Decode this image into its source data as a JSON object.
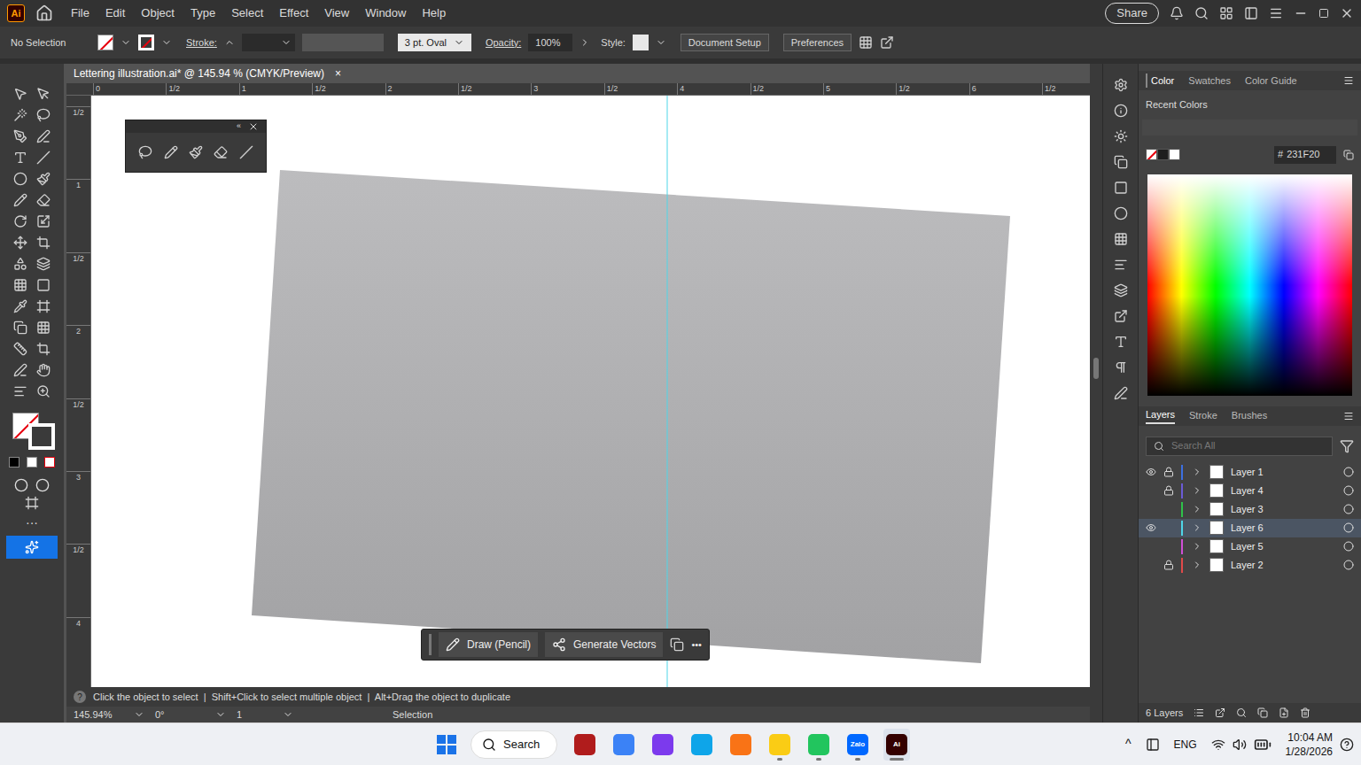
{
  "app": {
    "logo": "Ai"
  },
  "menu": [
    "File",
    "Edit",
    "Object",
    "Type",
    "Select",
    "Effect",
    "View",
    "Window",
    "Help"
  ],
  "share_button": "Share",
  "control_bar": {
    "selection": "No Selection",
    "stroke_label": "Stroke:",
    "brush": "3 pt. Oval",
    "opacity_label": "Opacity:",
    "opacity": "100%",
    "style_label": "Style:",
    "buttons": [
      "Document Setup",
      "Preferences"
    ]
  },
  "document_tab": {
    "title": "Lettering illustration.ai* @ 145.94 % (CMYK/Preview)",
    "close": "×"
  },
  "rulers": {
    "top": [
      "0",
      "1/2",
      "1",
      "1/2",
      "2",
      "1/2",
      "3",
      "1/2",
      "4",
      "1/2",
      "5",
      "1/2",
      "6",
      "1/2"
    ],
    "left": [
      "1/2",
      "1",
      "1/2",
      "2",
      "1/2",
      "3",
      "1/2",
      "4"
    ]
  },
  "task_bar": {
    "buttons": [
      "Draw (Pencil)",
      "Generate Vectors"
    ],
    "more": "•••"
  },
  "status_bar": {
    "help": "?",
    "hint": "Click the object to select  |  Shift+Click to select multiple object  |  Alt+Drag the object to duplicate",
    "zoom": "145.94%",
    "rotation": "0°",
    "artboard": "1",
    "tool": "Selection"
  },
  "color_panel": {
    "tabs": [
      {
        "label": "Color",
        "selected": true
      },
      {
        "label": "Swatches",
        "selected": false
      },
      {
        "label": "Color Guide",
        "selected": false
      }
    ],
    "recent_label": "Recent Colors",
    "recent_colors": [
      {
        "kind": "none",
        "color": "#ffffff"
      },
      {
        "kind": "fill",
        "color": "#1e1e1e"
      },
      {
        "kind": "fill",
        "color": "#ffffff"
      }
    ],
    "hex_prefix": "#",
    "hex": "231F20"
  },
  "layers_panel": {
    "tabs": [
      {
        "label": "Layers",
        "selected": true
      },
      {
        "label": "Stroke",
        "selected": false
      },
      {
        "label": "Brushes",
        "selected": false
      }
    ],
    "search_placeholder": "Search All",
    "layers": [
      {
        "name": "Layer 1",
        "visible": true,
        "locked": true,
        "selected": false,
        "color": "#3d6fe0"
      },
      {
        "name": "Layer 4",
        "visible": false,
        "locked": true,
        "selected": false,
        "color": "#6b5bd6"
      },
      {
        "name": "Layer 3",
        "visible": false,
        "locked": false,
        "selected": false,
        "color": "#2fc24a"
      },
      {
        "name": "Layer 6",
        "visible": true,
        "locked": false,
        "selected": true,
        "color": "#4fd6e8"
      },
      {
        "name": "Layer 5",
        "visible": false,
        "locked": false,
        "selected": false,
        "color": "#d04fd6"
      },
      {
        "name": "Layer 2",
        "visible": false,
        "locked": true,
        "selected": false,
        "color": "#e04a4a"
      }
    ],
    "count": "6 Layers"
  },
  "taskbar": {
    "search": "Search",
    "apps": [
      {
        "label": "",
        "color": "#b01c1c",
        "running": false,
        "selected": false
      },
      {
        "label": "",
        "color": "#3b82f6",
        "running": false,
        "selected": false
      },
      {
        "label": "",
        "color": "#7c3aed",
        "running": false,
        "selected": false
      },
      {
        "label": "",
        "color": "#0ea5e9",
        "running": false,
        "selected": false
      },
      {
        "label": "",
        "color": "#f97316",
        "running": false,
        "selected": false
      },
      {
        "label": "",
        "color": "#facc15",
        "running": true,
        "selected": false
      },
      {
        "label": "",
        "color": "#22c55e",
        "running": true,
        "selected": false
      },
      {
        "label": "Zalo",
        "color": "#0068ff",
        "running": true,
        "selected": false
      },
      {
        "label": "Ai",
        "color": "#330000",
        "running": true,
        "selected": true
      }
    ],
    "overflow": "^",
    "language": "ENG",
    "time": "10:04 AM",
    "date": "1/28/2026"
  }
}
